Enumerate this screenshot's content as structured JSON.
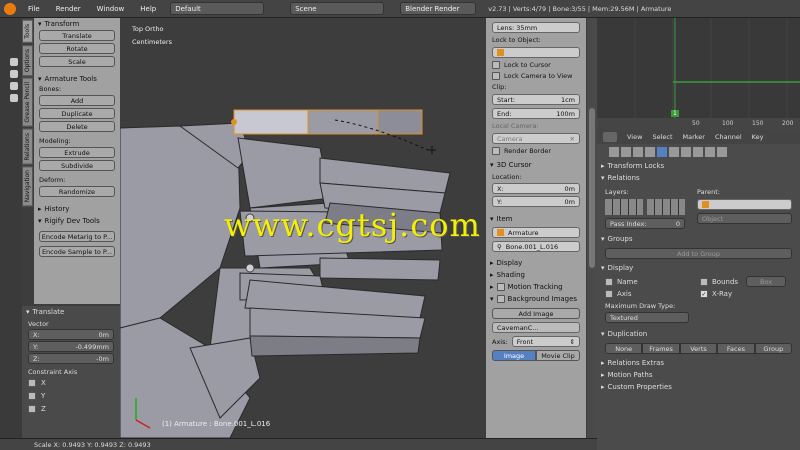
{
  "topbar": {
    "menus": [
      "File",
      "Render",
      "Window",
      "Help"
    ],
    "layout": "Default",
    "scene": "Scene",
    "engine": "Blender Render",
    "stats": "v2.73 | Verts:4/79 | Bone:3/55 | Mem:29.56M | Armature"
  },
  "tool_tabs": [
    "Tools",
    "Options",
    "Grease Pencil",
    "Relations",
    "Navigation"
  ],
  "tool_shelf": {
    "transform_header": "Transform",
    "transform_buttons": [
      "Translate",
      "Rotate",
      "Scale"
    ],
    "armature_header": "Armature Tools",
    "bones_label": "Bones:",
    "bones_buttons": [
      "Add",
      "Duplicate",
      "Delete"
    ],
    "modeling_label": "Modeling:",
    "modeling_buttons": [
      "Extrude",
      "Subdivide"
    ],
    "deform_label": "Deform:",
    "deform_buttons": [
      "Randomize"
    ],
    "history_header": "History",
    "rigify_header": "Rigify Dev Tools",
    "rigify_buttons": [
      "Encode Metarig to P...",
      "Encode Sample to P..."
    ]
  },
  "operator": {
    "header": "Translate",
    "vector_label": "Vector",
    "x": {
      "label": "X:",
      "value": "0m"
    },
    "y": {
      "label": "Y:",
      "value": "-0.499mm"
    },
    "z": {
      "label": "Z:",
      "value": "-0m"
    },
    "constraint_label": "Constraint Axis",
    "axes": [
      "X",
      "Y",
      "Z"
    ]
  },
  "viewport": {
    "view_name": "Top Ortho",
    "units": "Centimeters",
    "object_label": "(1) Armature : Bone.001_L.016",
    "watermark": "www.cgtsj.com",
    "colors": {
      "bg": "#3d3d3d",
      "bone": "#9b9ba6",
      "bone_selected": "#c8c8d2",
      "selection": "#e09020",
      "watermark": "#f5f000"
    }
  },
  "properties": {
    "lens": "Lens:        35mm",
    "lock_to_object": "Lock to Object:",
    "lock_to_cursor": "Lock to Cursor",
    "lock_camera": "Lock Camera to View",
    "clip_label": "Clip:",
    "clip_start": {
      "label": "Start:",
      "value": "1cm"
    },
    "clip_end": {
      "label": "End:",
      "value": "100m"
    },
    "local_camera": "Local Camera:",
    "camera_field": "Camera",
    "render_border": "Render Border",
    "cursor_header": "3D Cursor",
    "location_label": "Location:",
    "cursor_x": {
      "label": "X:",
      "value": "0m"
    },
    "cursor_y": {
      "label": "Y:",
      "value": "0m"
    },
    "item_header": "Item",
    "item_name": "Armature",
    "bone_name": "Bone.001_L.016",
    "display_header": "Display",
    "shading_header": "Shading",
    "motion_header": "Motion Tracking",
    "bg_images_header": "Background Images",
    "add_image": "Add Image",
    "caveman": "CavemanC...",
    "axis_label": "Axis:",
    "axis_value": "Front",
    "tab_image": "Image",
    "tab_movie": "Movie Clip"
  },
  "timeline": {
    "ticks": [
      "50",
      "100",
      "150",
      "200"
    ],
    "marker": "1"
  },
  "props_editor": {
    "menus": [
      "View",
      "Select",
      "Marker",
      "Channel",
      "Key"
    ],
    "transform_locks": "Transform Locks",
    "relations": "Relations",
    "layers": "Layers:",
    "parent": "Parent:",
    "pass_index": {
      "label": "Pass Index:",
      "value": "0"
    },
    "object": "Object",
    "groups": "Groups",
    "add_to_group": "Add to Group",
    "display": "Display",
    "name": "Name",
    "bounds": "Bounds",
    "box": "Box",
    "axis": "Axis",
    "xray": "X-Ray",
    "max_draw": "Maximum Draw Type:",
    "textured": "Textured",
    "duplication": "Duplication",
    "dup_options": [
      "None",
      "Frames",
      "Verts",
      "Faces",
      "Group"
    ],
    "relations_extras": "Relations Extras",
    "motion_paths": "Motion Paths",
    "custom_props": "Custom Properties"
  },
  "statusbar": "Scale X: 0.9493  Y: 0.9493  Z: 0.9493"
}
